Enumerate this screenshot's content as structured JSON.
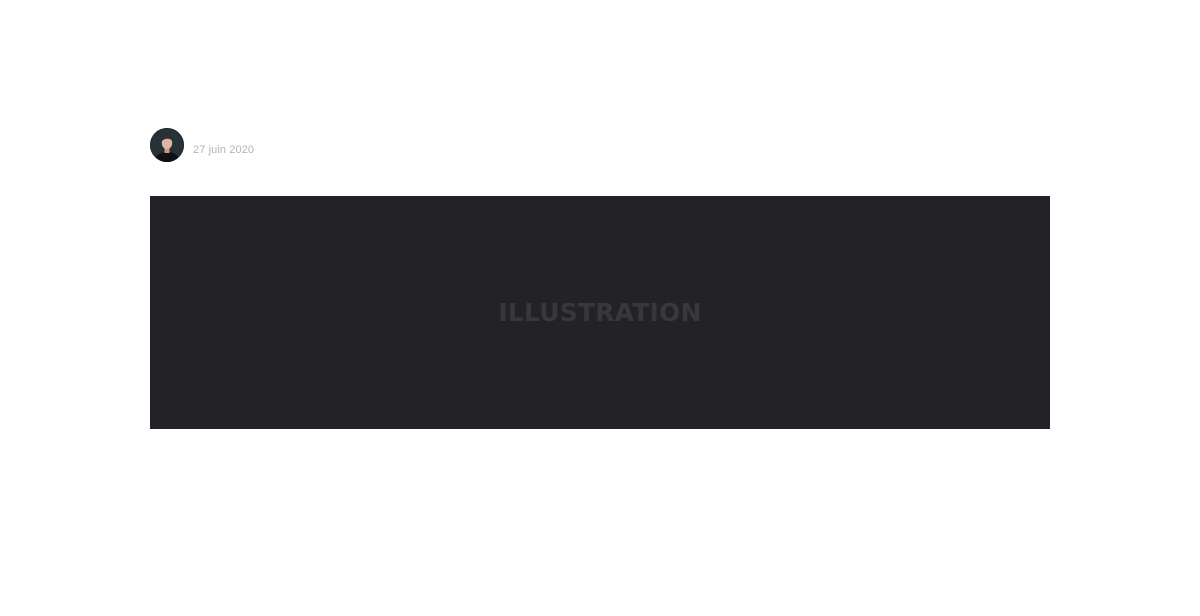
{
  "post": {
    "author_avatar": "author-avatar-photo",
    "date": "27 juin 2020"
  },
  "illustration": {
    "label": "ILLUSTRATION",
    "background_color": "#232226"
  }
}
